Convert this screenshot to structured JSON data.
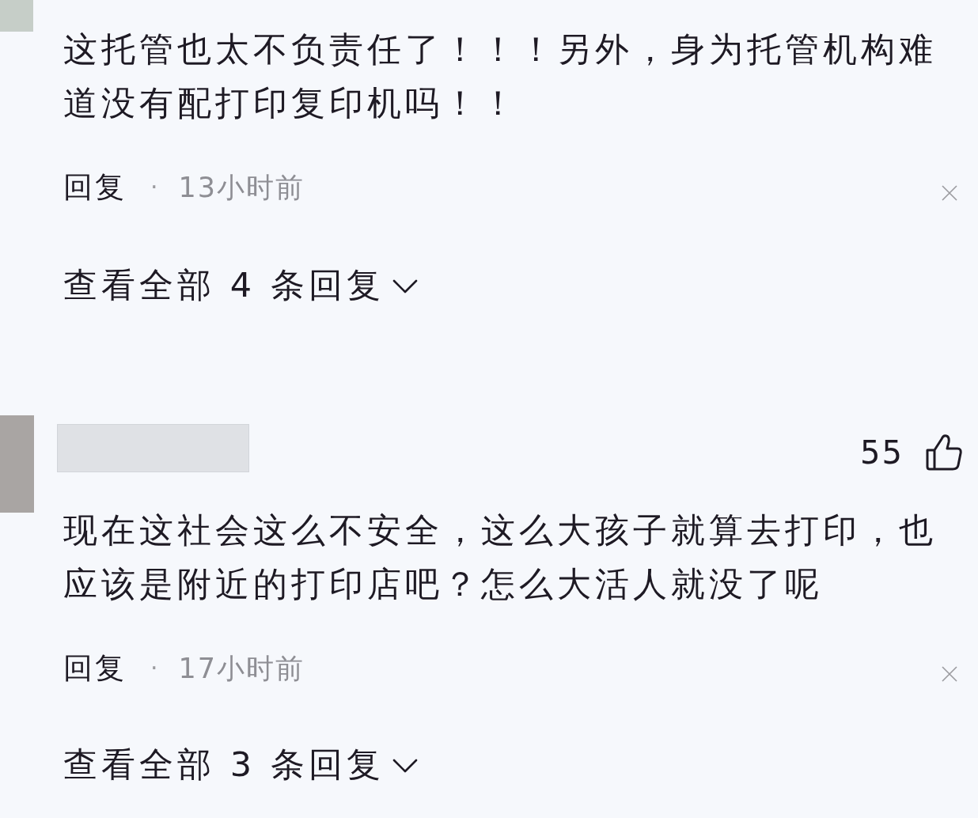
{
  "comments": [
    {
      "kind": "clipped",
      "text": "这托管也太不负责任了！！！另外，身为托管机构难道没有配打印复印机吗！！",
      "reply_label": "回复",
      "separator": "·",
      "time": "13小时前",
      "view_replies": "查看全部 4 条回复"
    },
    {
      "kind": "full",
      "likes": "55",
      "text": "现在这社会这么不安全，这么大孩子就算去打印，也应该是附近的打印店吧？怎么大活人就没了呢",
      "reply_label": "回复",
      "separator": "·",
      "time": "17小时前",
      "view_replies": "查看全部 3 条回复"
    }
  ]
}
